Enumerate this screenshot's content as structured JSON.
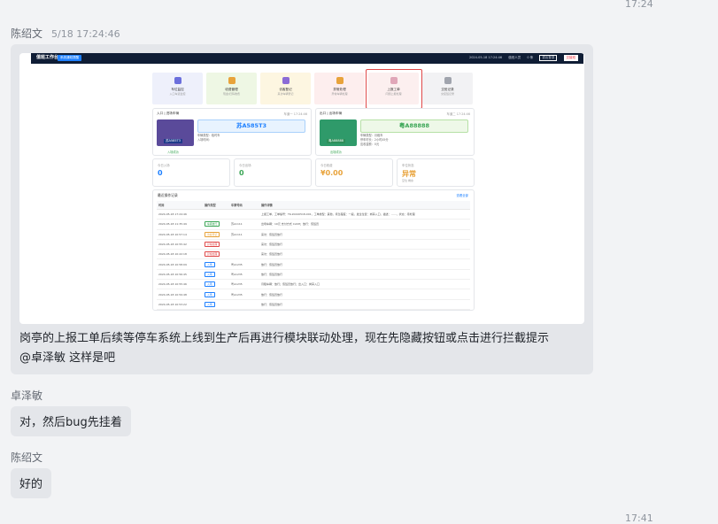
{
  "timestamps": {
    "top": "17:24",
    "bottom": "17:41"
  },
  "messages": [
    {
      "sender": "陈绍文",
      "time": "5/18 17:24:46"
    },
    {
      "sender": "卓泽敏",
      "text": "对，然后bug先挂着"
    },
    {
      "sender": "陈绍文",
      "text": "好的"
    }
  ],
  "main_message": {
    "line1": "岗亭的上报工单后续等停车系统上线到生产后再进行模块联动处理，现在先隐藏按钮或点击进行拦截提示",
    "line2": "@卓泽敏 这样是吧"
  },
  "screenshot": {
    "brand": "值班工作台",
    "tag": "系统通知提醒",
    "top_items": [
      "2024-05-18 17:24:46",
      "值班人员",
      "0 条",
      "退出登录",
      "交接班"
    ],
    "tiles": [
      {
        "label": "车位监控",
        "sub": "入口车道监控",
        "color": "#eef0fb",
        "icon_color": "#6b6fdc"
      },
      {
        "label": "收费管理",
        "sub": "现金/扫码收费",
        "color": "#eef7e4",
        "icon_color": "#e8a33b"
      },
      {
        "label": "访客登记",
        "sub": "来访车辆登记",
        "color": "#fdf6e1",
        "icon_color": "#8b6bd6"
      },
      {
        "label": "异常处理",
        "sub": "异常车辆处理",
        "color": "#fdeeee",
        "icon_color": "#e8a33b"
      },
      {
        "label": "上报工单",
        "sub": "问题上报处理",
        "color": "#fcefef",
        "icon_color": "#e0a6b8"
      },
      {
        "label": "交班记录",
        "sub": "交接班记录",
        "color": "#f2f2f4",
        "icon_color": "#a0a4ad"
      }
    ],
    "entry_card": {
      "title": "入口 | 进场车辆",
      "right": "车道一 17:24:46",
      "plate": "苏A585T3",
      "small_plate": "苏A585T3",
      "meta1": "车辆类型：临时车",
      "meta2": "入场时间：",
      "ok": "入场成功"
    },
    "exit_card": {
      "title": "出口 | 出场车辆",
      "right": "车道二 17:24:46",
      "plate": "粤A88888",
      "small_plate": "粤A88888",
      "meta1": "车辆类型：月租车",
      "meta2": "停车时长：2小时45分",
      "meta3": "应收金额：0元",
      "ok": "出场成功"
    },
    "stats": [
      {
        "label": "今日入场",
        "value": "0",
        "color": "#1e80ff",
        "sub": ""
      },
      {
        "label": "今日出场",
        "value": "0",
        "color": "#3aa655",
        "sub": ""
      },
      {
        "label": "今日收费",
        "value": "¥0.00",
        "color": "#e8a33b",
        "sub": ""
      },
      {
        "label": "车位状态",
        "value": "异常",
        "color": "#e8a33b",
        "sub": "空位 剩余"
      }
    ],
    "list": {
      "title": "最近操作记录",
      "more": "查看全部",
      "headers": [
        "时间",
        "操作类型",
        "车牌号码",
        "操作详情"
      ],
      "rows": [
        [
          "2024-05-18 17:24:46",
          "",
          "",
          "上报工单，工单编号：TK-20240518-001，工单类型：其他，紧急程度：一般，发生位置：岗亭入口，描述：……，状态：待处理"
        ],
        [
          "2024-05-18 11:35:49",
          "车辆放行",
          "苏A1111",
          "出场车辆：10元 支付方式 CASH；放行：值班员"
        ],
        [
          "2024-05-18 10:57:14",
          "访客登记",
          "苏A1111",
          "来访：值班员放行"
        ],
        [
          "2024-05-18 10:55:42",
          "异常处理",
          "",
          "来访：值班员放行"
        ],
        [
          "2024-05-18 10:22:18",
          "异常处理",
          "",
          "来访：值班员放行"
        ],
        [
          "2024-05-18 10:58:09",
          "入场",
          "粤A1235",
          "放行：值班员放行"
        ],
        [
          "2024-05-18 10:56:45",
          "入场",
          "粤A1235",
          "放行：值班员放行"
        ],
        [
          "2024-05-18 10:55:46",
          "入场",
          "粤A1235",
          "月租车辆：放行；值班员放行；出入口：岗亭入口"
        ],
        [
          "2024-05-18 10:59:48",
          "入场",
          "粤A1235",
          "放行：值班员放行"
        ],
        [
          "2024-05-18 10:53:22",
          "入场",
          "",
          "放行：值班员放行"
        ]
      ],
      "badge_colors": {
        "车辆放行": "#3aa655",
        "访客登记": "#e8a33b",
        "异常处理": "#e04848",
        "入场": "#1e80ff"
      }
    }
  }
}
